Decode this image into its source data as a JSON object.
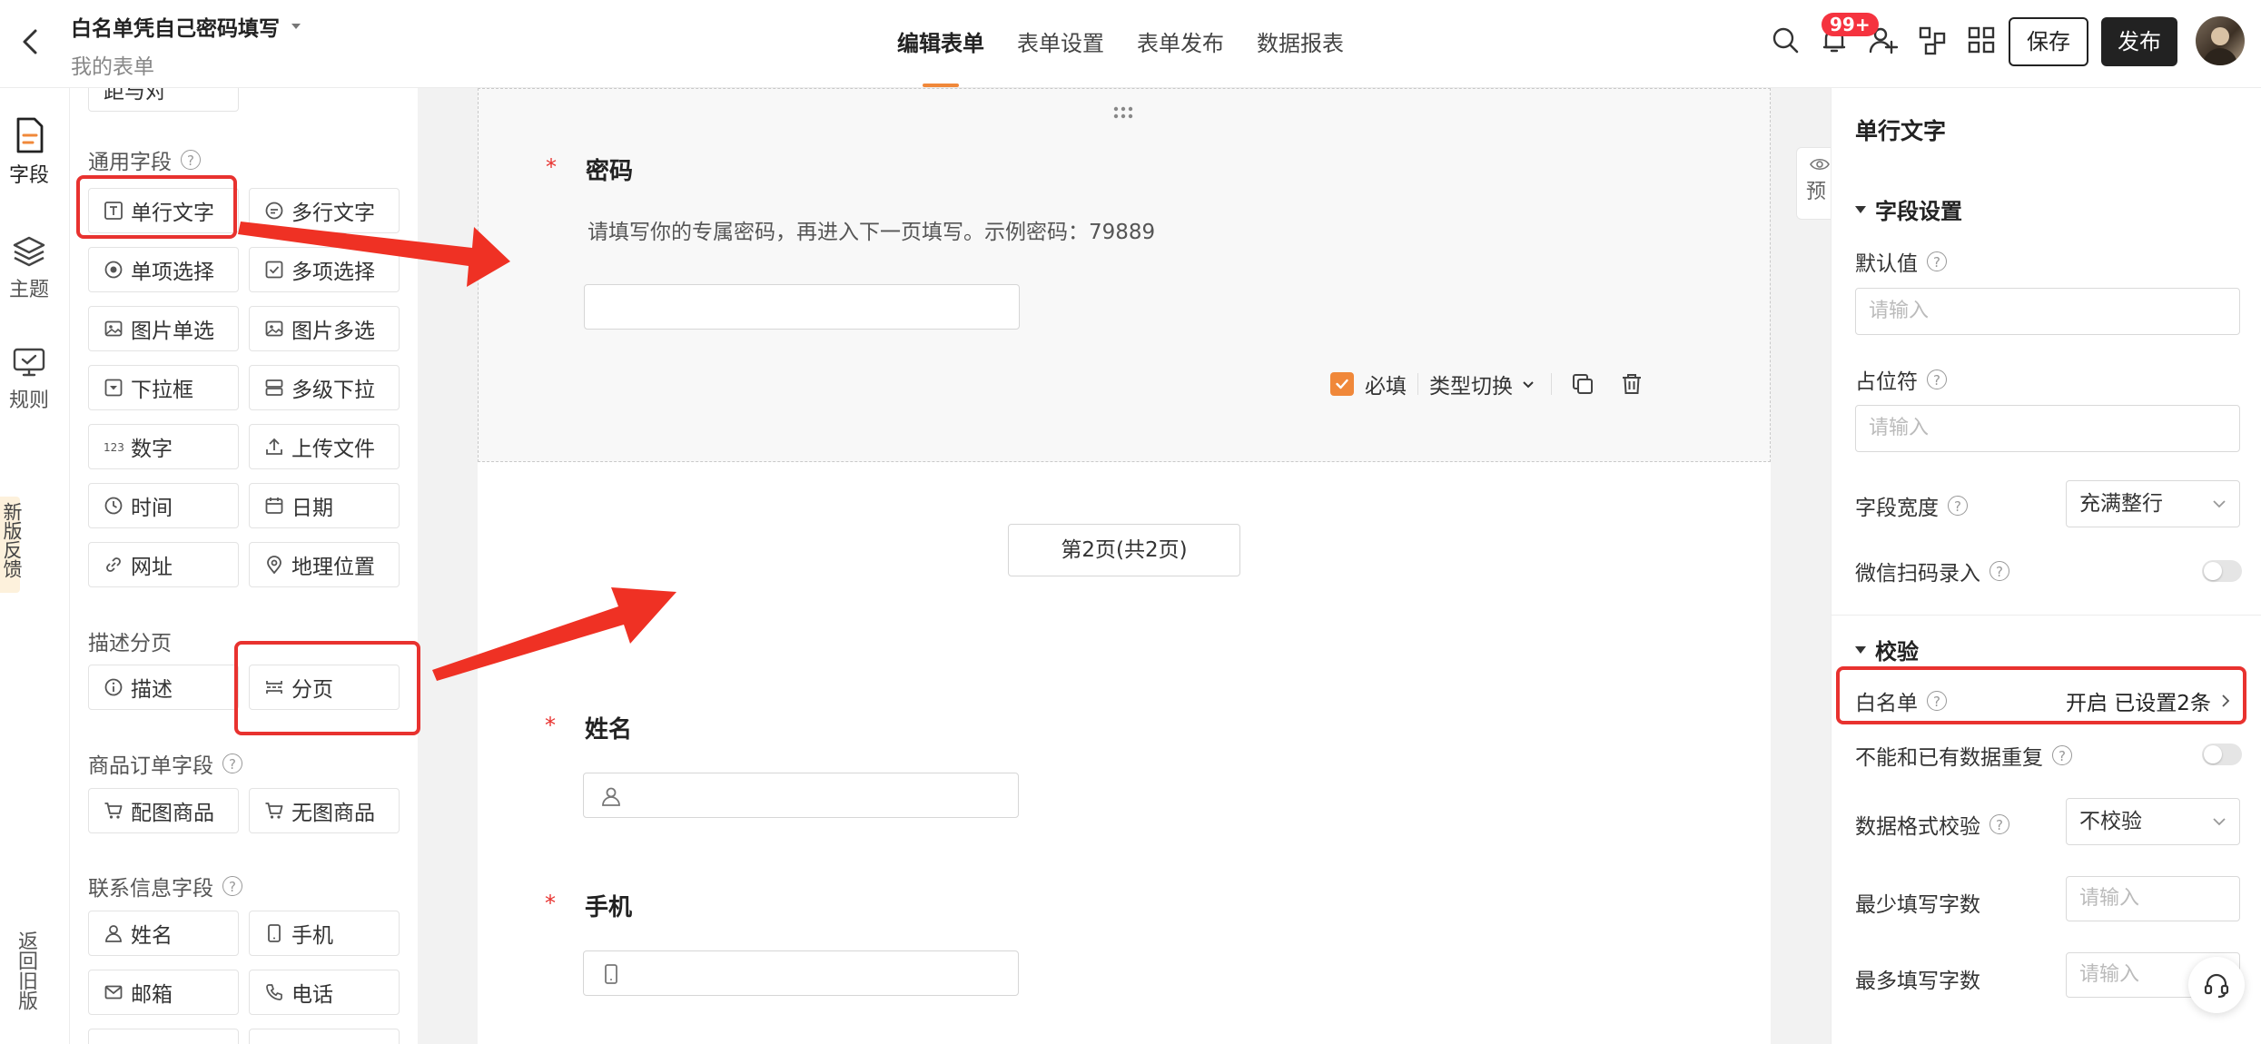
{
  "header": {
    "title": "白名单凭自己密码填写",
    "subtitle": "我的表单",
    "tabs": [
      {
        "label": "编辑表单",
        "active": true
      },
      {
        "label": "表单设置",
        "active": false
      },
      {
        "label": "表单发布",
        "active": false
      },
      {
        "label": "数据报表",
        "active": false
      }
    ],
    "notification_badge": "99+",
    "save_label": "保存",
    "publish_label": "发布",
    "icons": [
      "search-icon",
      "bell-icon",
      "add-user-icon",
      "flow-icon",
      "grid-icon"
    ]
  },
  "rail": {
    "items": [
      {
        "label": "字段",
        "icon": "field-icon",
        "active": true
      },
      {
        "label": "主题",
        "icon": "layers-icon",
        "active": false
      },
      {
        "label": "规则",
        "icon": "rule-icon",
        "active": false
      }
    ],
    "feedback": "新版反馈",
    "old_version": "返回旧版"
  },
  "fields_panel": {
    "partial_top": "距与对",
    "groups": [
      {
        "title": "通用字段",
        "has_help": true
      },
      {
        "title": "描述分页",
        "has_help": false
      },
      {
        "title": "商品订单字段",
        "has_help": true
      },
      {
        "title": "联系信息字段",
        "has_help": true
      }
    ],
    "items": {
      "single_text": "单行文字",
      "multi_text": "多行文字",
      "single_choice": "单项选择",
      "multi_choice": "多项选择",
      "image_single": "图片单选",
      "image_multi": "图片多选",
      "dropdown": "下拉框",
      "cascade": "多级下拉",
      "number": "数字",
      "upload": "上传文件",
      "time": "时间",
      "date": "日期",
      "url": "网址",
      "location": "地理位置",
      "description": "描述",
      "pagination": "分页",
      "product_img": "配图商品",
      "product_noimg": "无图商品",
      "name": "姓名",
      "phone": "手机",
      "email": "邮箱",
      "tel": "电话"
    }
  },
  "canvas": {
    "password": {
      "required_mark": "*",
      "title": "密码",
      "description": "请填写你的专属密码，再进入下一页填写。示例密码：79889",
      "value": ""
    },
    "tools": {
      "required_label": "必填",
      "type_switch_label": "类型切换",
      "required_checked": true
    },
    "pager_label": "第2页(共2页)",
    "name_field": {
      "required_mark": "*",
      "title": "姓名"
    },
    "phone_field": {
      "required_mark": "*",
      "title": "手机"
    },
    "preview_tab": "预"
  },
  "props": {
    "title": "单行文字",
    "section_field": "字段设置",
    "default_value": {
      "label": "默认值",
      "placeholder": "请输入"
    },
    "placeholder_cfg": {
      "label": "占位符",
      "placeholder": "请输入"
    },
    "width": {
      "label": "字段宽度",
      "value": "充满整行"
    },
    "wechat_scan": {
      "label": "微信扫码录入",
      "enabled": false
    },
    "section_validate": "校验",
    "whitelist": {
      "label": "白名单",
      "value": "开启 已设置2条"
    },
    "no_duplicate": {
      "label": "不能和已有数据重复",
      "enabled": false
    },
    "format_check": {
      "label": "数据格式校验",
      "value": "不校验"
    },
    "min_chars": {
      "label": "最少填写字数",
      "placeholder": "请输入"
    },
    "max_chars": {
      "label": "最多填写字数",
      "placeholder": "请输入"
    }
  },
  "colors": {
    "accent": "#f0883a",
    "highlight": "#e8322f",
    "badge": "#f5333f"
  }
}
